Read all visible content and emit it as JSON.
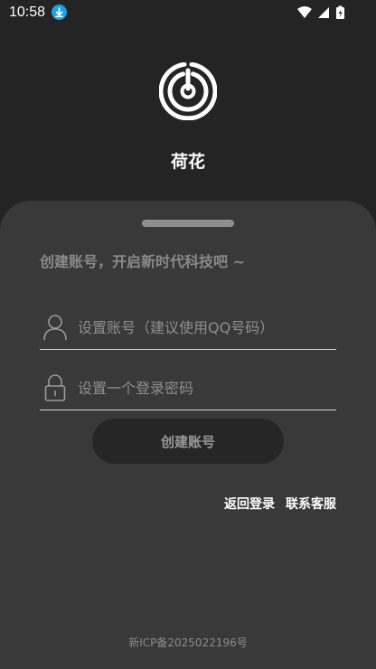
{
  "status_bar": {
    "time": "10:58",
    "download_icon": "download-arrow-icon",
    "wifi_icon": "wifi-icon",
    "signal_icon": "cell-signal-icon",
    "battery_icon": "battery-charging-icon"
  },
  "header": {
    "logo_icon": "radar-power-logo",
    "app_name": "荷花"
  },
  "form": {
    "tagline": "创建账号，开启新时代科技吧 ~",
    "account_placeholder": "设置账号（建议使用QQ号码）",
    "password_placeholder": "设置一个登录密码",
    "account_value": "",
    "password_value": "",
    "create_button": "创建账号"
  },
  "links": {
    "back_login": "返回登录",
    "contact_service": "联系客服"
  },
  "footer": {
    "icp": "新ICP备2025022196号"
  },
  "colors": {
    "background": "#242424",
    "sheet": "#393939",
    "button": "#262626",
    "download_badge": "#1aa1ec"
  }
}
